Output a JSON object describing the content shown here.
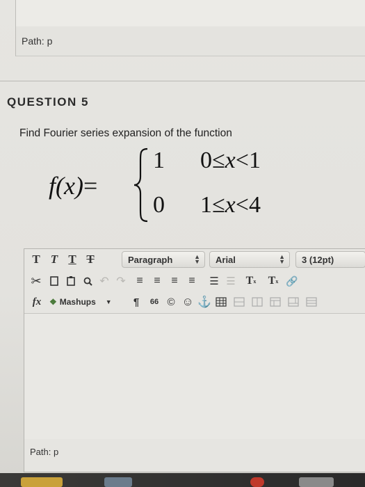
{
  "top_path": {
    "label": "Path: p"
  },
  "question": {
    "title": "QUESTION 5",
    "prompt": "Find Fourier series expansion of the function",
    "formula": {
      "lhs": "f(x)",
      "equals": "=",
      "cases": [
        {
          "value": "1",
          "condition_left": "0",
          "rel1": "≤",
          "var": "x",
          "rel2": "<",
          "condition_right": "1"
        },
        {
          "value": "0",
          "condition_left": "1",
          "rel1": "≤",
          "var": "x",
          "rel2": "<",
          "condition_right": "4"
        }
      ]
    }
  },
  "editor": {
    "format_buttons": [
      "T",
      "T",
      "T",
      "T"
    ],
    "paragraph_select": "Paragraph",
    "font_select": "Arial",
    "size_select": "3 (12pt)",
    "superscript": "T",
    "subscript": "T",
    "fx_label": "fx",
    "mashups_label": "Mashups",
    "pilcrow": "¶",
    "quote": "66",
    "copyright": "©",
    "path_label": "Path: p"
  },
  "icons": {
    "cut": "scissors-icon",
    "copy": "copy-icon",
    "paste": "paste-icon",
    "find": "search-icon",
    "undo": "undo-icon",
    "redo": "redo-icon",
    "align": "align-icon",
    "list": "list-icon",
    "emoji": "emoji-icon",
    "anchor": "anchor-icon",
    "table": "table-icon",
    "link": "link-icon"
  }
}
